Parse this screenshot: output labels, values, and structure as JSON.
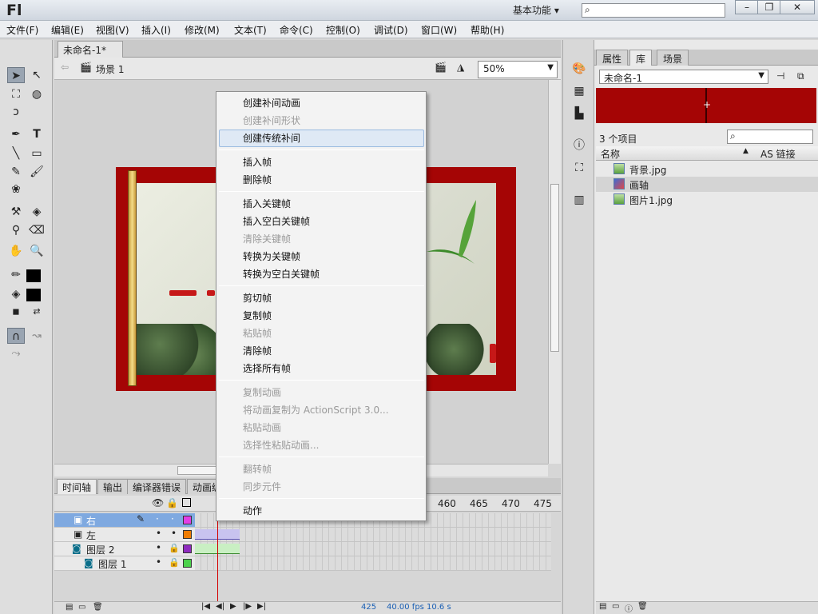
{
  "app": {
    "logo": "Fl",
    "workspace": "基本功能 ▾"
  },
  "window_buttons": [
    "–",
    "❐",
    "✕"
  ],
  "menubar": [
    "文件(F)",
    "编辑(E)",
    "视图(V)",
    "插入(I)",
    "修改(M)",
    "文本(T)",
    "命令(C)",
    "控制(O)",
    "调试(D)",
    "窗口(W)",
    "帮助(H)"
  ],
  "document": {
    "tab": "未命名-1*",
    "close": "×",
    "scene": "场景 1",
    "zoom": "50%"
  },
  "library": {
    "tabs": [
      "属性",
      "库",
      "场景"
    ],
    "active_tab": "库",
    "doc_select": "未命名-1",
    "item_count": "3 个项目",
    "columns": {
      "name": "名称",
      "linkage": "AS 链接"
    },
    "items": [
      {
        "name": "背景.jpg",
        "type": "bitmap"
      },
      {
        "name": "画轴",
        "type": "movieclip"
      },
      {
        "name": "图片1.jpg",
        "type": "bitmap"
      }
    ]
  },
  "timeline": {
    "tabs": [
      "时间轴",
      "输出",
      "编译器错误",
      "动画编"
    ],
    "active_tab": "时间轴",
    "frame_numbers": [
      "460",
      "465",
      "470",
      "475"
    ],
    "layers": [
      {
        "name": "右",
        "color": "#e33de6",
        "selected": true
      },
      {
        "name": "左",
        "color": "#f07c00",
        "selected": false
      },
      {
        "name": "图层 2",
        "color": "#8f2bbf",
        "selected": false
      },
      {
        "name": "图层 1",
        "color": "#4cd24c",
        "selected": false
      }
    ],
    "footer": {
      "frame": "425",
      "fps": "40.00 fps",
      "time": "10.6 s"
    }
  },
  "context_menu": {
    "groups": [
      [
        {
          "label": "创建补间动画",
          "enabled": true
        },
        {
          "label": "创建补间形状",
          "enabled": false
        },
        {
          "label": "创建传统补间",
          "enabled": true,
          "highlighted": true
        }
      ],
      [
        {
          "label": "插入帧",
          "enabled": true
        },
        {
          "label": "删除帧",
          "enabled": true
        }
      ],
      [
        {
          "label": "插入关键帧",
          "enabled": true
        },
        {
          "label": "插入空白关键帧",
          "enabled": true
        },
        {
          "label": "清除关键帧",
          "enabled": false
        },
        {
          "label": "转换为关键帧",
          "enabled": true
        },
        {
          "label": "转换为空白关键帧",
          "enabled": true
        }
      ],
      [
        {
          "label": "剪切帧",
          "enabled": true
        },
        {
          "label": "复制帧",
          "enabled": true
        },
        {
          "label": "粘贴帧",
          "enabled": false
        },
        {
          "label": "清除帧",
          "enabled": true
        },
        {
          "label": "选择所有帧",
          "enabled": true
        }
      ],
      [
        {
          "label": "复制动画",
          "enabled": false
        },
        {
          "label": "将动画复制为 ActionScript 3.0...",
          "enabled": false
        },
        {
          "label": "粘贴动画",
          "enabled": false
        },
        {
          "label": "选择性粘贴动画...",
          "enabled": false
        }
      ],
      [
        {
          "label": "翻转帧",
          "enabled": false
        },
        {
          "label": "同步元件",
          "enabled": false
        }
      ],
      [
        {
          "label": "动作",
          "enabled": true
        }
      ]
    ]
  },
  "colors": {
    "frame_red": "#a50505",
    "selected_layer": "#7fa9e0",
    "playhead": "#d40000"
  }
}
